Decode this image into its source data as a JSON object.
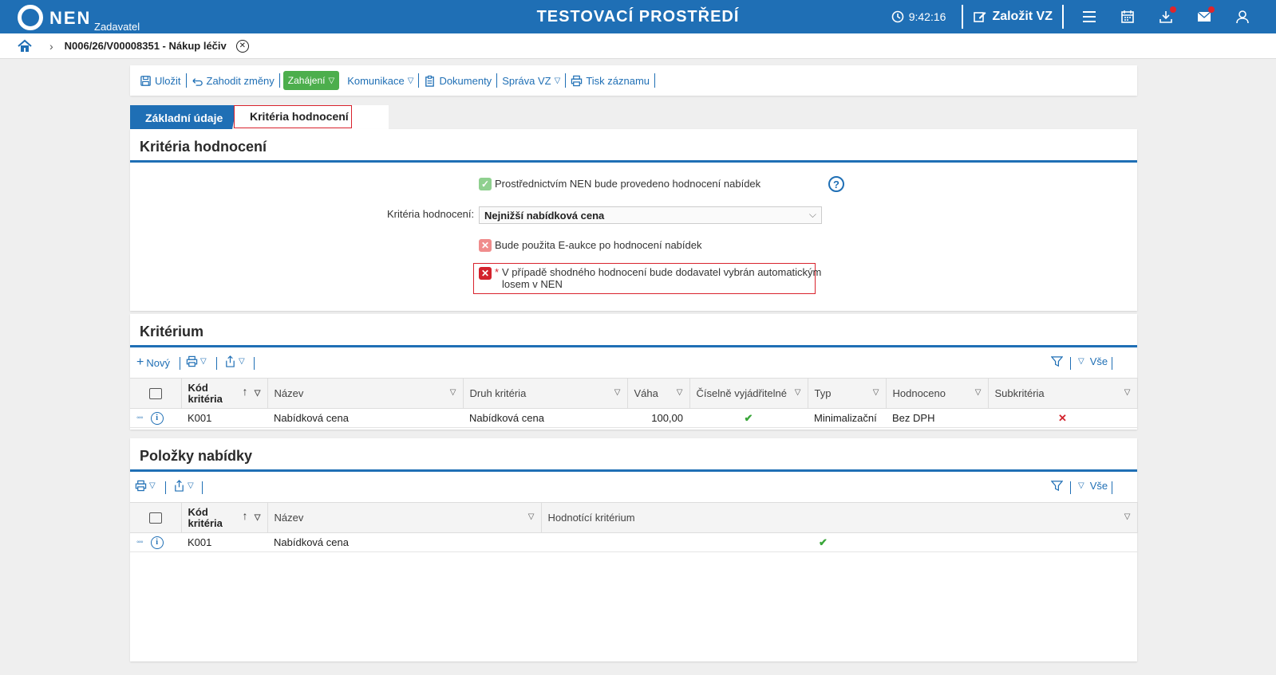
{
  "header": {
    "logo_text": "NEN",
    "logo_sub": "Zadavatel",
    "env_title": "TESTOVACÍ PROSTŘEDÍ",
    "clock": "9:42:16",
    "create_label": "Založit VZ",
    "icons": [
      "clock-icon",
      "edit-icon",
      "menu-icon",
      "calendar-icon",
      "download-icon",
      "mail-icon",
      "user-icon"
    ]
  },
  "breadcrumb": {
    "item": "N006/26/V00008351 - Nákup léčiv"
  },
  "toolbar": {
    "save": "Uložit",
    "discard": "Zahodit změny",
    "start": "Zahájení",
    "communication": "Komunikace",
    "documents": "Dokumenty",
    "manage": "Správa VZ",
    "print": "Tisk záznamu"
  },
  "tabs": {
    "basic": "Základní údaje",
    "criteria": "Kritéria hodnocení"
  },
  "criteria_panel": {
    "title": "Kritéria hodnocení",
    "nen_eval_label": "Prostřednictvím NEN bude provedeno hodnocení nabídek",
    "criteria_label": "Kritéria hodnocení:",
    "criteria_value": "Nejnižší nabídková cena",
    "eauction_label": "Bude použita E-aukce po hodnocení nabídek",
    "tie_required": "*",
    "tie_line1": "V případě shodného hodnocení bude dodavatel vybrán automatickým",
    "tie_line2": "losem v NEN",
    "help": "?"
  },
  "criterion_panel": {
    "title": "Kritérium",
    "new_label": "Nový",
    "all_label": "Vše",
    "columns": [
      "Kód kritéria",
      "Název",
      "Druh kritéria",
      "Váha",
      "Číselně vyjádřitelné",
      "Typ",
      "Hodnoceno",
      "Subkritéria"
    ],
    "rows": [
      {
        "code": "K001",
        "name": "Nabídková cena",
        "kind": "Nabídková cena",
        "weight": "100,00",
        "numeric": true,
        "type": "Minimalizační",
        "evaluated": "Bez DPH",
        "subcriteria": false
      }
    ]
  },
  "items_panel": {
    "title": "Položky nabídky",
    "all_label": "Vše",
    "columns": [
      "Kód kritéria",
      "Název",
      "Hodnotící kritérium"
    ],
    "rows": [
      {
        "code": "K001",
        "name": "Nabídková cena",
        "evaluating": true
      }
    ]
  },
  "colors": {
    "primary": "#1f6fb5",
    "green": "#4cae4c",
    "error": "#d9232d"
  }
}
